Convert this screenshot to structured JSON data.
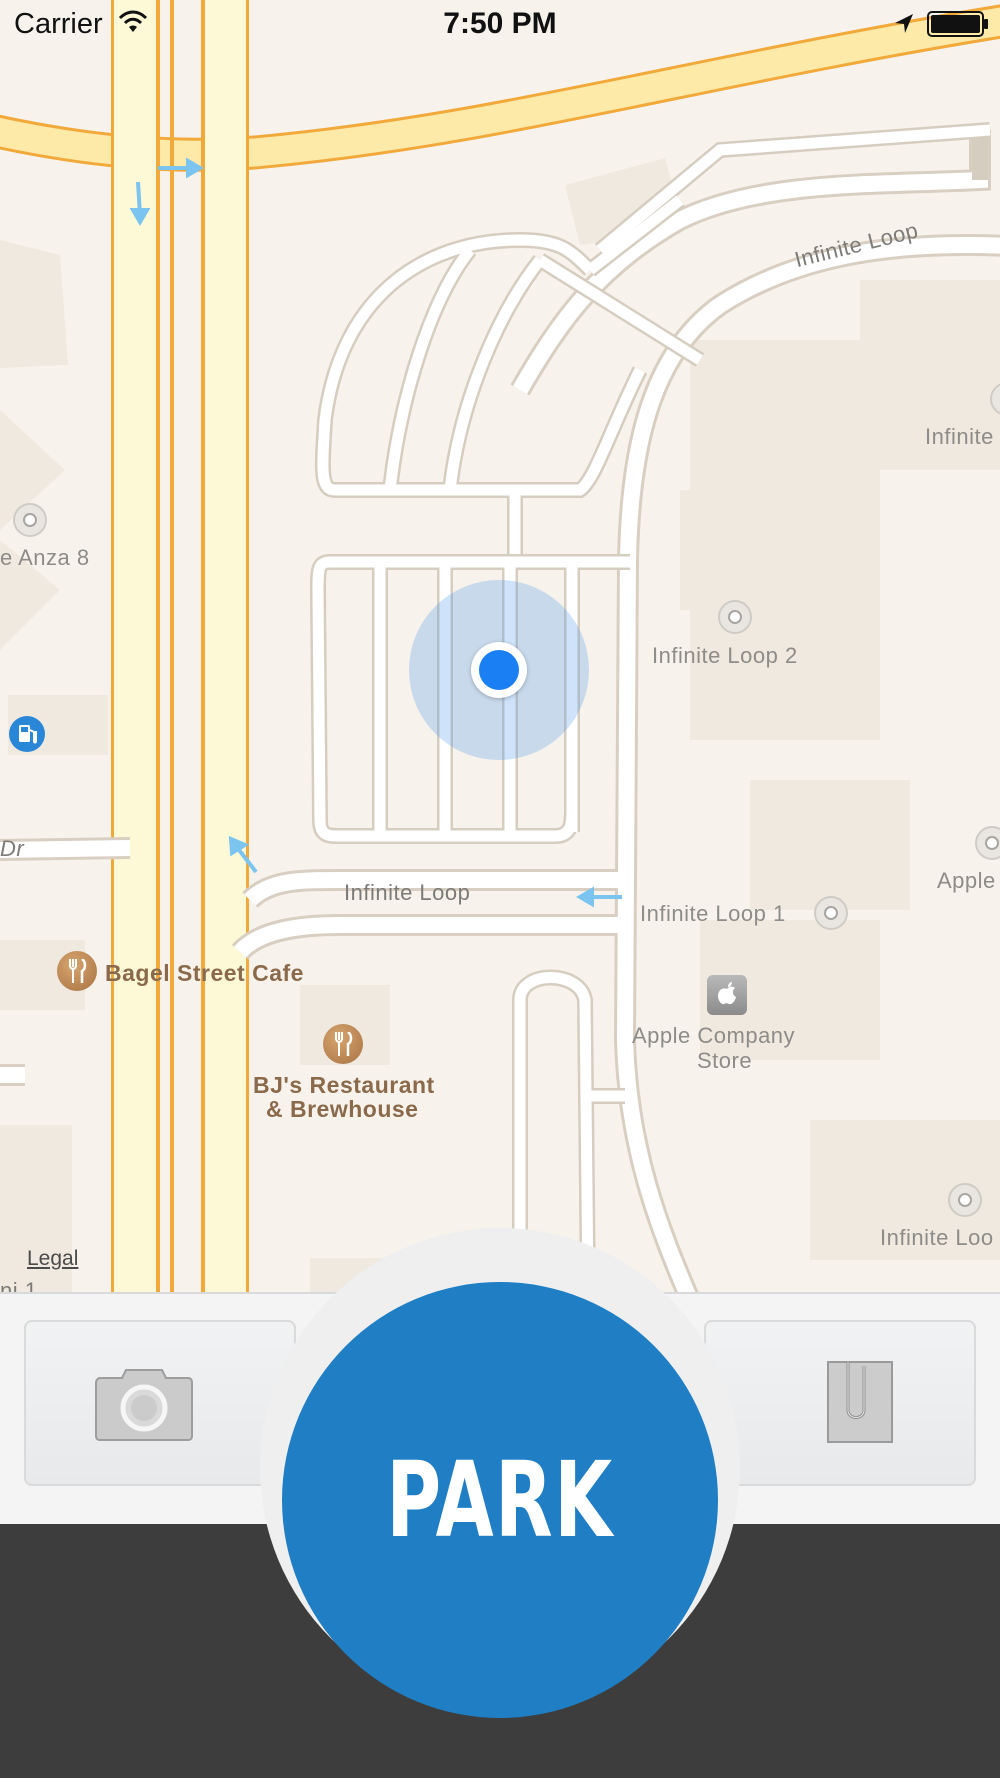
{
  "status_bar": {
    "carrier": "Carrier",
    "time": "7:50 PM",
    "icons": [
      "wifi-icon",
      "location-arrow-icon",
      "battery-icon"
    ]
  },
  "map": {
    "streets": {
      "infinite_loop_top": "Infinite Loop",
      "infinite_loop_bottom": "Infinite Loop",
      "dr_fragment": "Dr",
      "bottom_left_fragment": "ni 1"
    },
    "pois": {
      "anza": "e Anza 8",
      "infinite_top_right": "Infinite",
      "infinite_loop_2": "Infinite Loop 2",
      "infinite_loop_1": "Infinite Loop 1",
      "apple_right": "Apple",
      "bagel_street_cafe": "Bagel Street Cafe",
      "bjs_line1": "BJ's Restaurant",
      "bjs_line2": "& Brewhouse",
      "apple_store_line1": "Apple Company",
      "apple_store_line2": "Store",
      "infinite_bottom_right": "Infinite Loo"
    },
    "legal": "Legal",
    "colors": {
      "land": "#f7f3ec",
      "highway": "#fdf6cf",
      "highway_edge": "#f2a93b",
      "accuracy": "#5096eb",
      "user_dot": "#1a7ff2"
    }
  },
  "toolbar": {
    "camera_icon": "camera-icon",
    "clip_icon": "paperclip-icon"
  },
  "park_button": {
    "label": "PARK",
    "color": "#1f7ec4"
  }
}
